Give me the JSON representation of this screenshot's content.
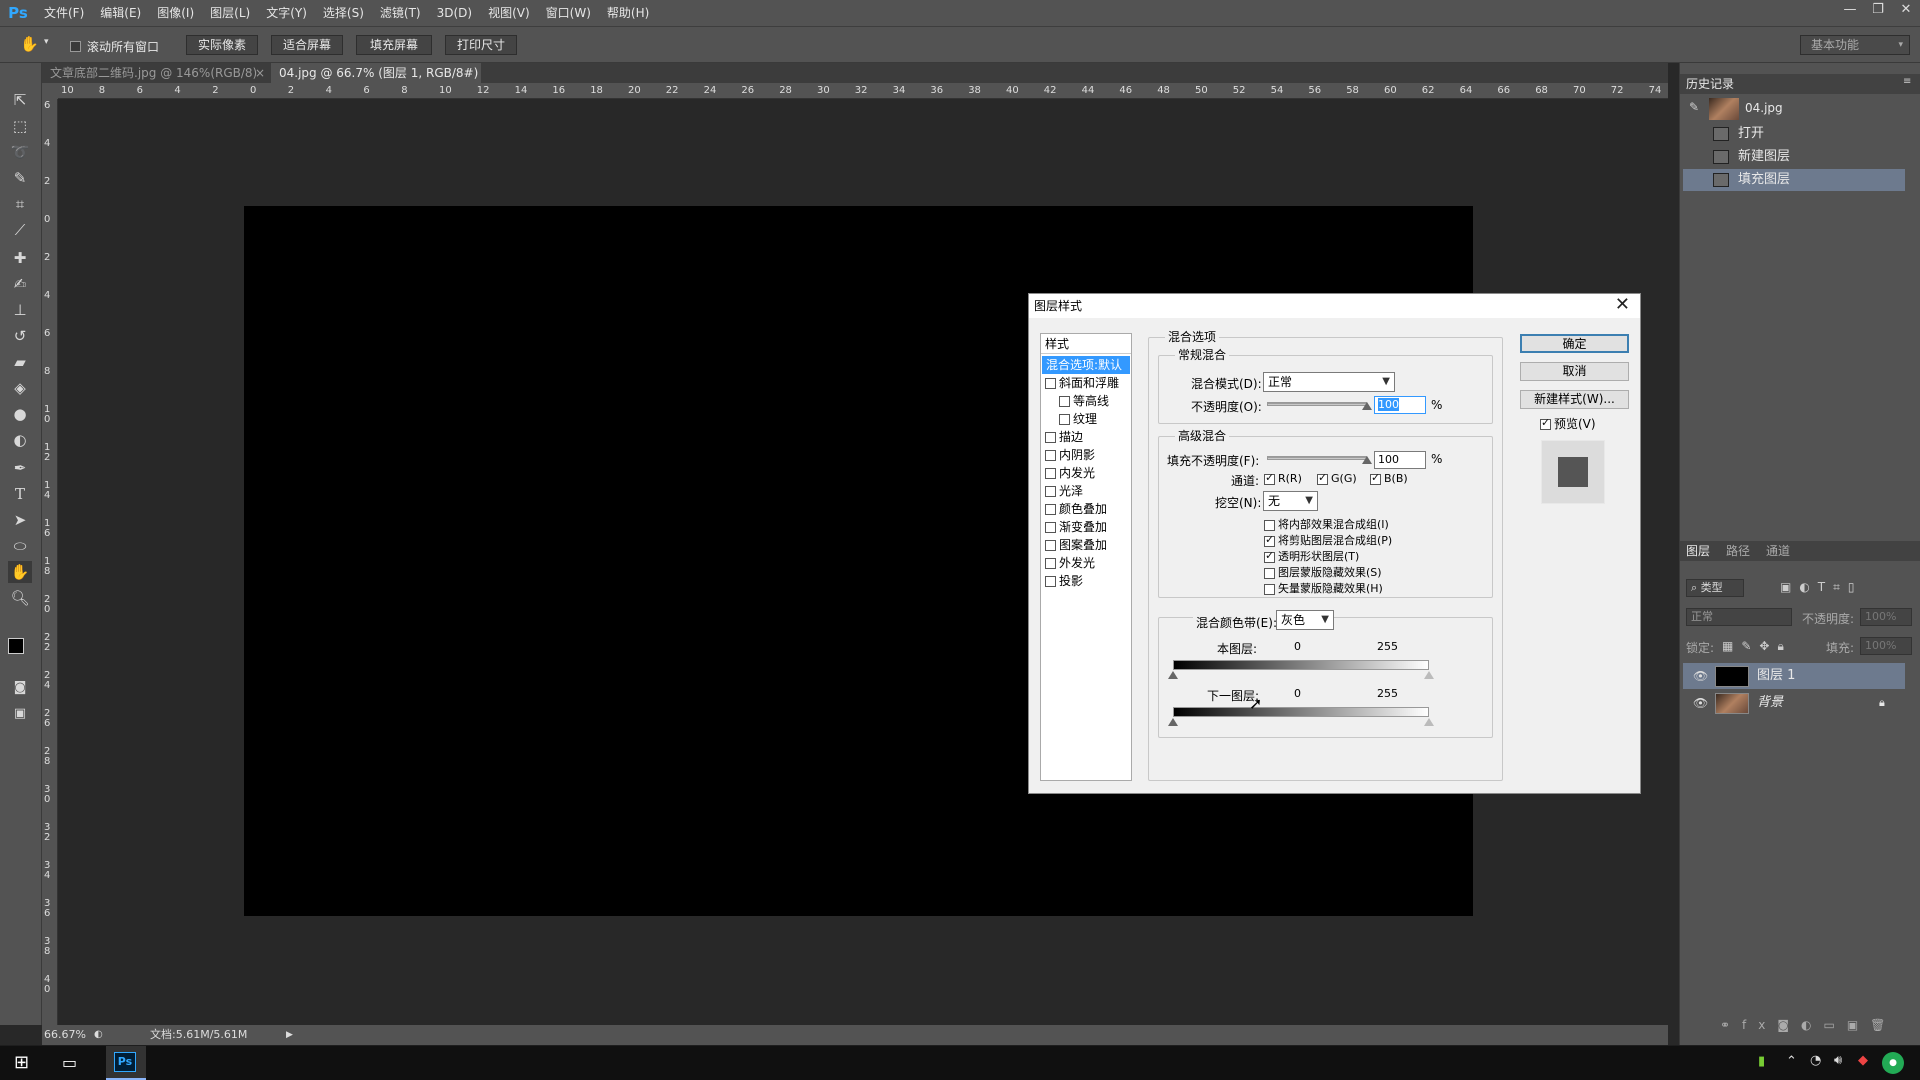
{
  "app": {
    "logo": "Ps"
  },
  "menu": [
    "文件(F)",
    "编辑(E)",
    "图像(I)",
    "图层(L)",
    "文字(Y)",
    "选择(S)",
    "滤镜(T)",
    "3D(D)",
    "视图(V)",
    "窗口(W)",
    "帮助(H)"
  ],
  "options": {
    "scroll_all_label": "滚动所有窗口",
    "scroll_all_checked": false,
    "actual_pixels": "实际像素",
    "fit_screen": "适合屏幕",
    "fill_screen": "填充屏幕",
    "print_size": "打印尺寸",
    "workspace": "基本功能"
  },
  "tabs": [
    {
      "label": "文章底部二维码.jpg @ 146%(RGB/8)",
      "close": "×"
    },
    {
      "label": "04.jpg @ 66.7% (图层 1, RGB/8#) *",
      "close": "×"
    }
  ],
  "ruler_h": [
    "10",
    "8",
    "6",
    "4",
    "2",
    "0",
    "2",
    "4",
    "6",
    "8",
    "10",
    "12",
    "14",
    "16",
    "18",
    "20",
    "22",
    "24",
    "26",
    "28",
    "30",
    "32",
    "34",
    "36",
    "38",
    "40",
    "42",
    "44",
    "46",
    "48",
    "50",
    "52",
    "54",
    "56",
    "58",
    "60",
    "62",
    "64",
    "66",
    "68",
    "70",
    "72",
    "74"
  ],
  "ruler_v": [
    "6",
    "4",
    "2",
    "0",
    "2",
    "4",
    "6",
    "8",
    "10",
    "12",
    "14",
    "16",
    "18",
    "20",
    "22",
    "24",
    "26",
    "28",
    "30",
    "32",
    "34",
    "36",
    "38",
    "40"
  ],
  "status": {
    "zoom": "66.67%",
    "doc": "文档:5.61M/5.61M"
  },
  "history": {
    "tab": "历史记录",
    "snapshot": "04.jpg",
    "items": [
      {
        "label": "打开",
        "selected": false
      },
      {
        "label": "新建图层",
        "selected": false
      },
      {
        "label": "填充图层",
        "selected": true
      }
    ]
  },
  "layers_panel": {
    "tabs": [
      "图层",
      "路径",
      "通道"
    ],
    "filter": "类型",
    "blend": "正常",
    "opacity_label": "不透明度:",
    "opacity": "100%",
    "lock_label": "锁定:",
    "fill_label": "填充:",
    "fill": "100%",
    "layers": [
      {
        "name": "图层 1",
        "selected": true
      },
      {
        "name": "背景",
        "selected": false
      }
    ]
  },
  "dialog": {
    "title": "图层样式",
    "close": "✕",
    "styles_header": "样式",
    "styles": [
      {
        "label": "混合选项:默认",
        "checkbox": false,
        "selected": true
      },
      {
        "label": "斜面和浮雕",
        "checkbox": true
      },
      {
        "label": "等高线",
        "checkbox": true,
        "indent": true
      },
      {
        "label": "纹理",
        "checkbox": true,
        "indent": true
      },
      {
        "label": "描边",
        "checkbox": true
      },
      {
        "label": "内阴影",
        "checkbox": true
      },
      {
        "label": "内发光",
        "checkbox": true
      },
      {
        "label": "光泽",
        "checkbox": true
      },
      {
        "label": "颜色叠加",
        "checkbox": true
      },
      {
        "label": "渐变叠加",
        "checkbox": true
      },
      {
        "label": "图案叠加",
        "checkbox": true
      },
      {
        "label": "外发光",
        "checkbox": true
      },
      {
        "label": "投影",
        "checkbox": true
      }
    ],
    "blend_options_title": "混合选项",
    "general_title": "常规混合",
    "blend_mode_label": "混合模式(D):",
    "blend_mode": "正常",
    "opacity_label": "不透明度(O):",
    "opacity": "100",
    "percent": "%",
    "advanced_title": "高级混合",
    "fill_opacity_label": "填充不透明度(F):",
    "fill_opacity": "100",
    "channels_label": "通道:",
    "channels": [
      {
        "label": "R(R)",
        "checked": true
      },
      {
        "label": "G(G)",
        "checked": true
      },
      {
        "label": "B(B)",
        "checked": true
      }
    ],
    "knockout_label": "挖空(N):",
    "knockout": "无",
    "advanced_checks": [
      {
        "label": "将内部效果混合成组(I)",
        "checked": false
      },
      {
        "label": "将剪贴图层混合成组(P)",
        "checked": true
      },
      {
        "label": "透明形状图层(T)",
        "checked": true
      },
      {
        "label": "图层蒙版隐藏效果(S)",
        "checked": false
      },
      {
        "label": "矢量蒙版隐藏效果(H)",
        "checked": false
      }
    ],
    "blend_if_label": "混合颜色带(E):",
    "blend_if": "灰色",
    "this_layer_label": "本图层:",
    "this_layer_min": "0",
    "this_layer_max": "255",
    "underlying_label": "下一图层:",
    "underlying_min": "0",
    "underlying_max": "255",
    "ok": "确定",
    "cancel": "取消",
    "new_style": "新建样式(W)...",
    "preview_label": "预览(V)",
    "preview_checked": true
  }
}
